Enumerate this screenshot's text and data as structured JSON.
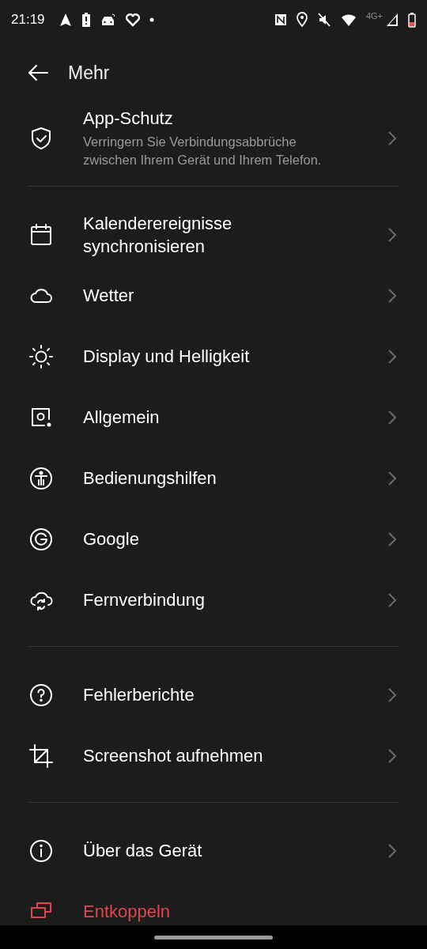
{
  "status_bar": {
    "time": "21:19",
    "network": "4G+"
  },
  "header": {
    "title": "Mehr"
  },
  "sections": [
    [
      {
        "title": "App-Schutz",
        "subtitle": "Verringern Sie Verbindungsabbrüche zwischen Ihrem Gerät und Ihrem Telefon.",
        "kind": "normal"
      }
    ],
    [
      {
        "title": "Kalenderereignisse synchronisieren",
        "kind": "normal"
      },
      {
        "title": "Wetter",
        "kind": "normal"
      },
      {
        "title": "Display und Helligkeit",
        "kind": "normal"
      },
      {
        "title": "Allgemein",
        "kind": "normal"
      },
      {
        "title": "Bedienungshilfen",
        "kind": "normal"
      },
      {
        "title": "Google",
        "kind": "normal"
      },
      {
        "title": "Fernverbindung",
        "kind": "normal"
      }
    ],
    [
      {
        "title": "Fehlerberichte",
        "kind": "normal"
      },
      {
        "title": "Screenshot aufnehmen",
        "kind": "normal"
      }
    ],
    [
      {
        "title": "Über das Gerät",
        "kind": "normal"
      },
      {
        "title": "Entkoppeln",
        "kind": "danger"
      }
    ]
  ]
}
